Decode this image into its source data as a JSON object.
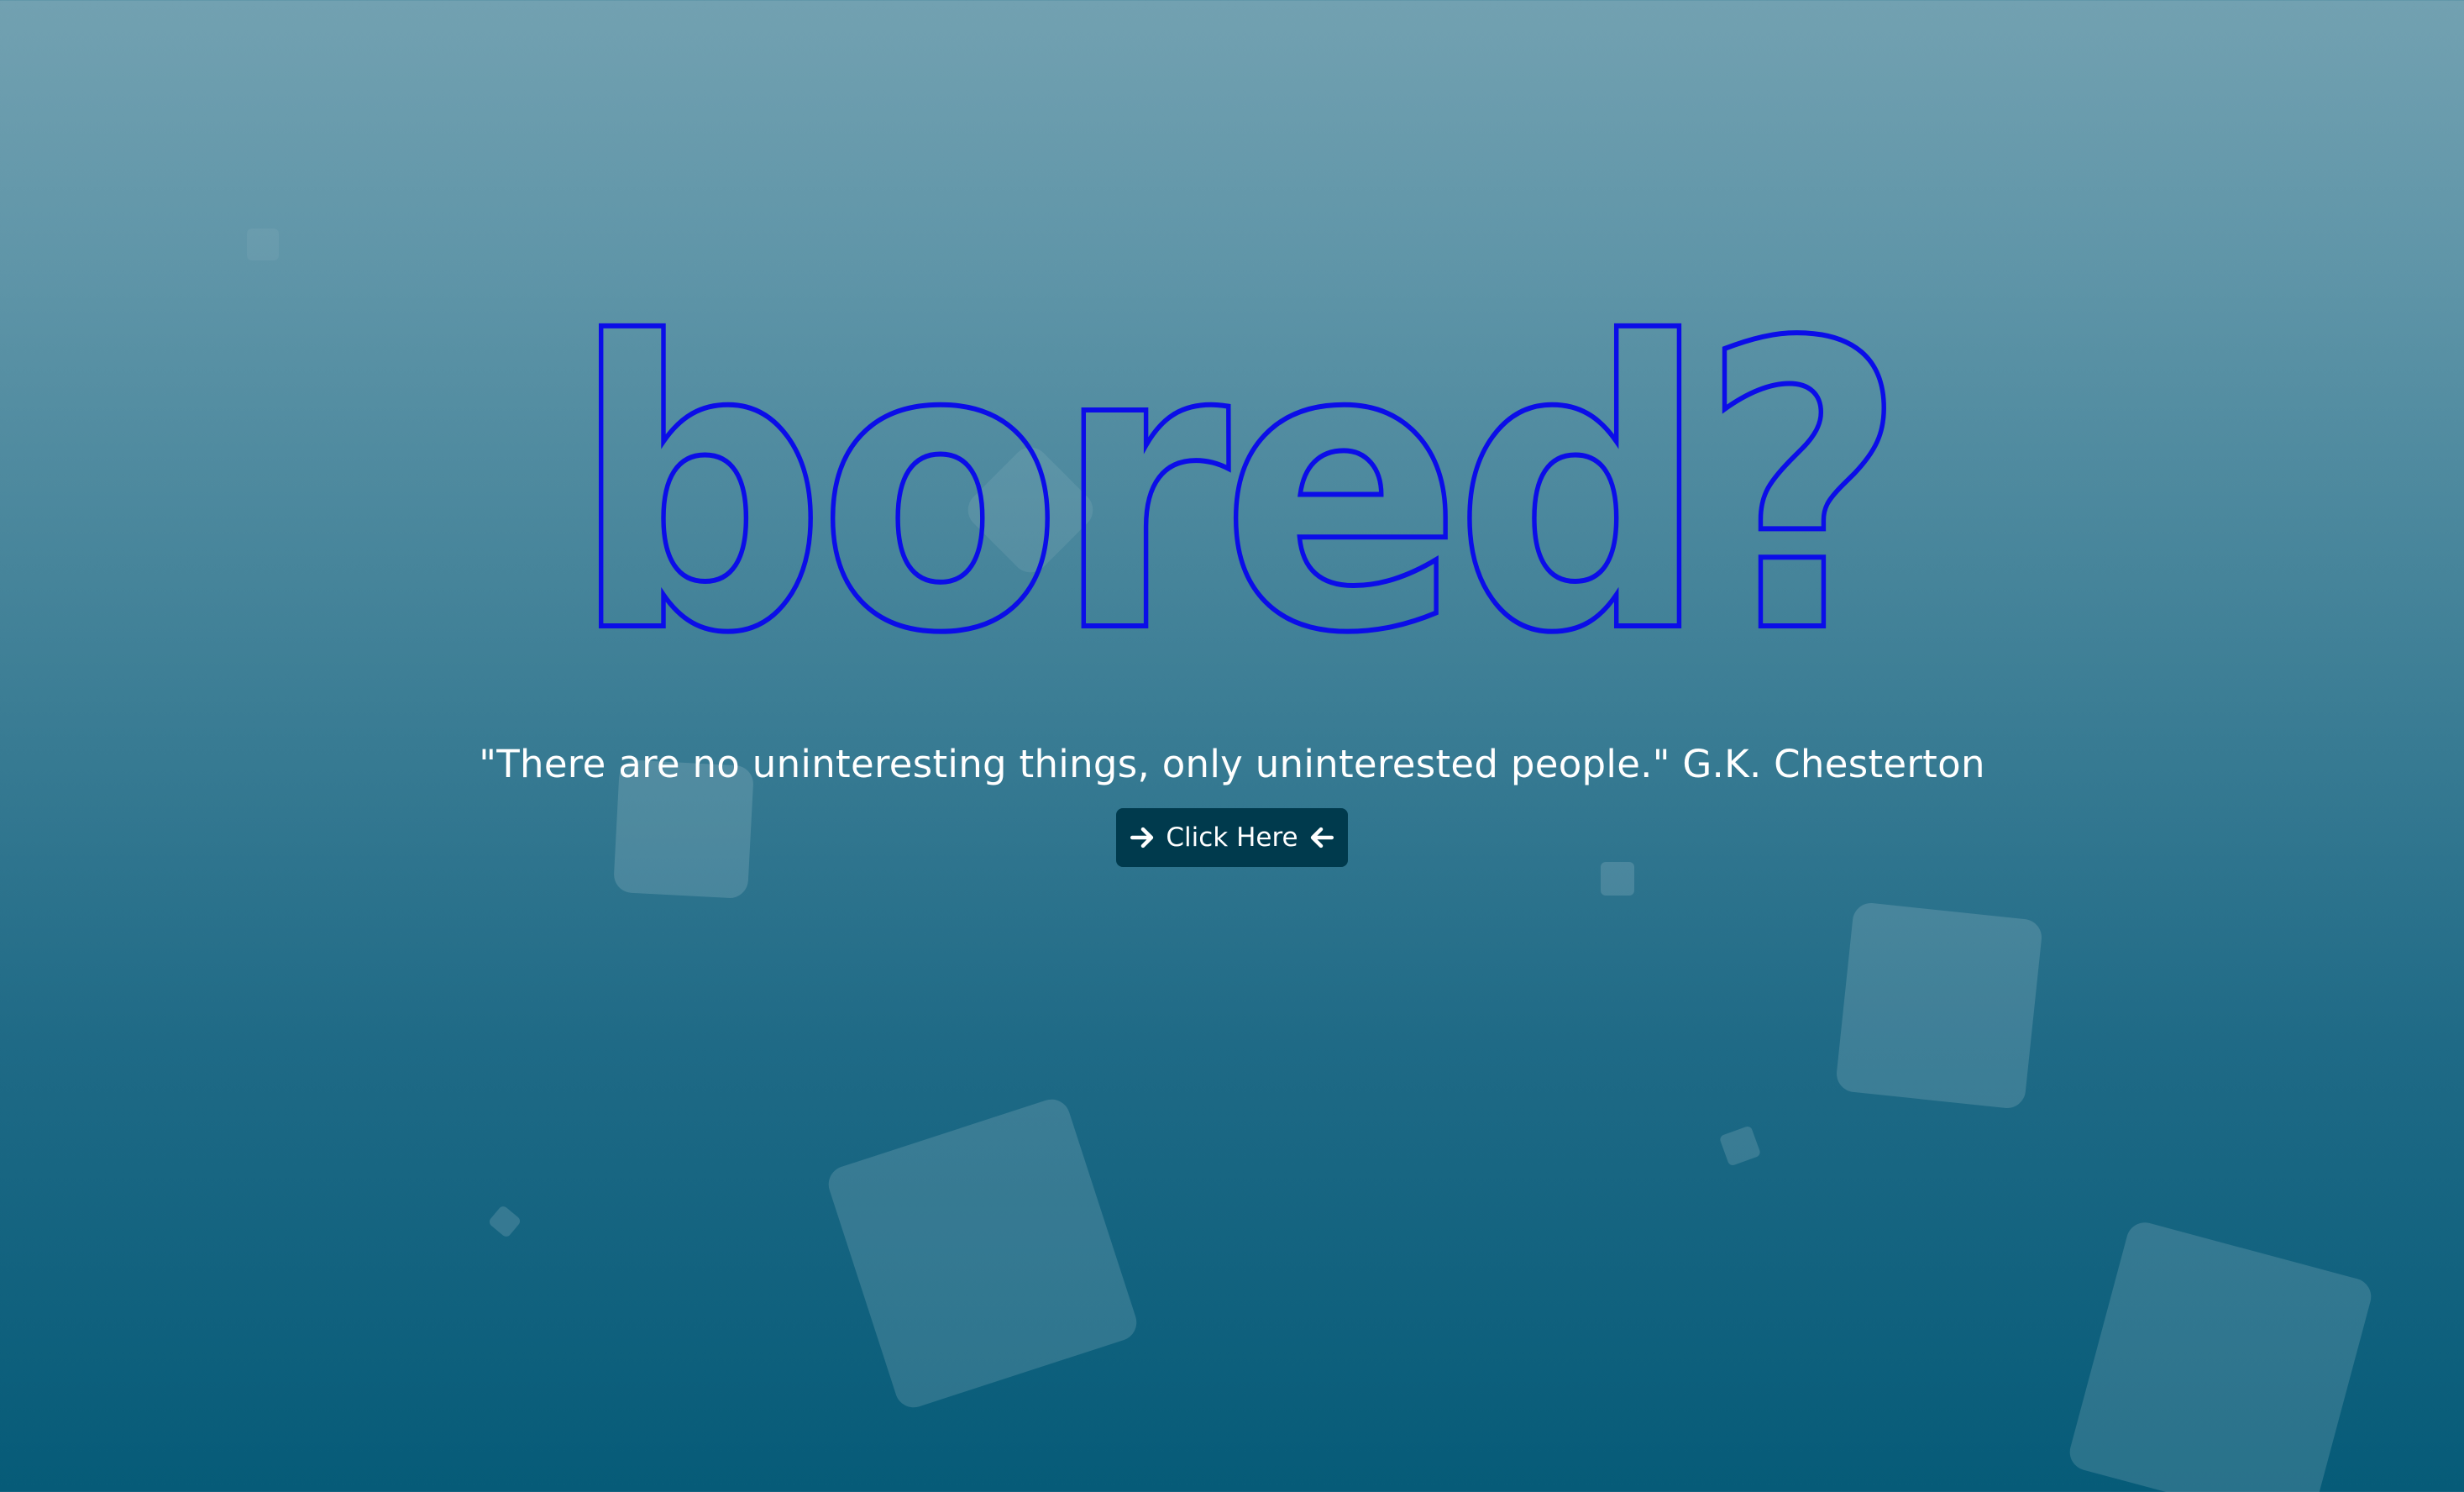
{
  "hero": {
    "title": "bored?",
    "quote": "\"There are no uninteresting things, only uninterested people.\" G.K. Chesterton",
    "button_label": "Click Here",
    "left_icon": "arrow-right-icon",
    "right_icon": "arrow-left-icon"
  },
  "colors": {
    "title_outline": "#0b0de8",
    "button_background": "#003a4d",
    "background_top": "#72a1b1",
    "background_bottom": "#065b78"
  }
}
